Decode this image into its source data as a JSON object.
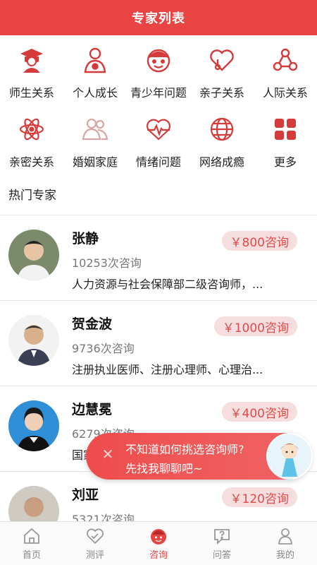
{
  "header": {
    "title": "专家列表"
  },
  "categories": [
    {
      "label": "师生关系",
      "icon": "graduation-cap-icon"
    },
    {
      "label": "个人成长",
      "icon": "person-icon"
    },
    {
      "label": "青少年问题",
      "icon": "child-face-icon"
    },
    {
      "label": "亲子关系",
      "icon": "heart-link-icon"
    },
    {
      "label": "人际关系",
      "icon": "network-icon"
    },
    {
      "label": "亲密关系",
      "icon": "atom-icon"
    },
    {
      "label": "婚姻家庭",
      "icon": "couple-icon"
    },
    {
      "label": "情绪问题",
      "icon": "heartbeat-icon"
    },
    {
      "label": "网络成瘾",
      "icon": "globe-icon"
    },
    {
      "label": "更多",
      "icon": "grid-icon"
    }
  ],
  "section": {
    "title": "热门专家"
  },
  "experts": [
    {
      "name": "张静",
      "count": "10253次咨询",
      "desc": "人力资源与社会保障部二级咨询师，...",
      "price": "￥800咨询"
    },
    {
      "name": "贺金波",
      "count": "9736次咨询",
      "desc": "注册执业医师、注册心理师、心理治...",
      "price": "￥1000咨询"
    },
    {
      "name": "边慧冕",
      "count": "6279次咨询",
      "desc": "国家",
      "price": "￥400咨询"
    },
    {
      "name": "刘亚",
      "count": "5321次咨询",
      "desc": "",
      "price": "￥120咨询"
    }
  ],
  "float": {
    "close": "✕",
    "line1": "不知道如何挑选咨询师?",
    "line2": "先找我聊聊吧~"
  },
  "tabs": [
    {
      "label": "首页",
      "icon": "home-icon"
    },
    {
      "label": "测评",
      "icon": "heart-check-icon"
    },
    {
      "label": "咨询",
      "icon": "consult-icon",
      "active": true
    },
    {
      "label": "问答",
      "icon": "qa-icon"
    },
    {
      "label": "我的",
      "icon": "user-icon"
    }
  ],
  "colors": {
    "brand": "#e94444",
    "price_bg": "#f7dede",
    "price_text": "#e04a4a"
  }
}
